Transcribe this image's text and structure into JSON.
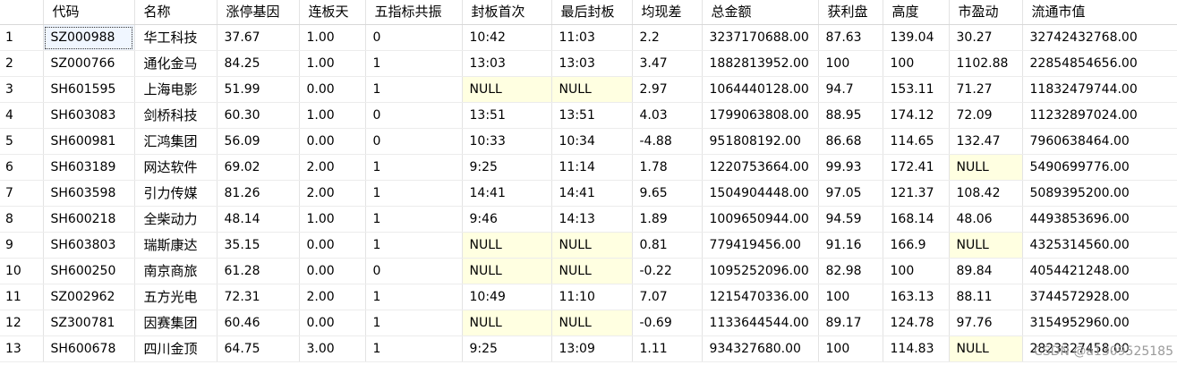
{
  "columns": [
    "",
    "代码",
    "名称",
    "涨停基因",
    "连板天",
    "五指标共振",
    "封板首次",
    "最后封板",
    "均现差",
    "总金额",
    "获利盘",
    "高度",
    "市盈动",
    "流通市值"
  ],
  "rows": [
    [
      "1",
      "SZ000988",
      "华工科技",
      "37.67",
      "1.00",
      "0",
      "10:42",
      "11:03",
      "2.2",
      "3237170688.00",
      "87.63",
      "139.04",
      "30.27",
      "32742432768.00"
    ],
    [
      "2",
      "SZ000766",
      "通化金马",
      "84.25",
      "1.00",
      "1",
      "13:03",
      "13:03",
      "3.47",
      "1882813952.00",
      "100",
      "100",
      "1102.88",
      "22854854656.00"
    ],
    [
      "3",
      "SH601595",
      "上海电影",
      "51.99",
      "0.00",
      "1",
      "NULL",
      "NULL",
      "2.97",
      "1064440128.00",
      "94.7",
      "153.11",
      "71.27",
      "11832479744.00"
    ],
    [
      "4",
      "SH603083",
      "剑桥科技",
      "60.30",
      "1.00",
      "0",
      "13:51",
      "13:51",
      "4.03",
      "1799063808.00",
      "88.95",
      "174.12",
      "72.09",
      "11232897024.00"
    ],
    [
      "5",
      "SH600981",
      "汇鸿集团",
      "56.09",
      "0.00",
      "0",
      "10:33",
      "10:34",
      "-4.88",
      "951808192.00",
      "86.68",
      "114.65",
      "132.47",
      "7960638464.00"
    ],
    [
      "6",
      "SH603189",
      "网达软件",
      "69.02",
      "2.00",
      "1",
      "9:25",
      "11:14",
      "1.78",
      "1220753664.00",
      "99.93",
      "172.41",
      "NULL",
      "5490699776.00"
    ],
    [
      "7",
      "SH603598",
      "引力传媒",
      "81.26",
      "2.00",
      "1",
      "14:41",
      "14:41",
      "9.65",
      "1504904448.00",
      "97.05",
      "121.37",
      "108.42",
      "5089395200.00"
    ],
    [
      "8",
      "SH600218",
      "全柴动力",
      "48.14",
      "1.00",
      "1",
      "9:46",
      "14:13",
      "1.89",
      "1009650944.00",
      "94.59",
      "168.14",
      "48.06",
      "4493853696.00"
    ],
    [
      "9",
      "SH603803",
      "瑞斯康达",
      "35.15",
      "0.00",
      "1",
      "NULL",
      "NULL",
      "0.81",
      "779419456.00",
      "91.16",
      "166.9",
      "NULL",
      "4325314560.00"
    ],
    [
      "10",
      "SH600250",
      "南京商旅",
      "61.28",
      "0.00",
      "0",
      "NULL",
      "NULL",
      "-0.22",
      "1095252096.00",
      "82.98",
      "100",
      "89.84",
      "4054421248.00"
    ],
    [
      "11",
      "SZ002962",
      "五方光电",
      "72.31",
      "2.00",
      "1",
      "10:49",
      "11:10",
      "7.07",
      "1215470336.00",
      "100",
      "163.13",
      "88.11",
      "3744572928.00"
    ],
    [
      "12",
      "SZ300781",
      "因赛集团",
      "60.46",
      "0.00",
      "1",
      "NULL",
      "NULL",
      "-0.69",
      "1133644544.00",
      "89.17",
      "124.78",
      "97.76",
      "3154952960.00"
    ],
    [
      "13",
      "SH600678",
      "四川金顶",
      "64.75",
      "3.00",
      "1",
      "9:25",
      "13:09",
      "1.11",
      "934327680.00",
      "100",
      "114.83",
      "NULL",
      "2823327458.00"
    ]
  ],
  "null_fill_color": "#ffffe1",
  "watermark": "CSDN @a1309525185"
}
